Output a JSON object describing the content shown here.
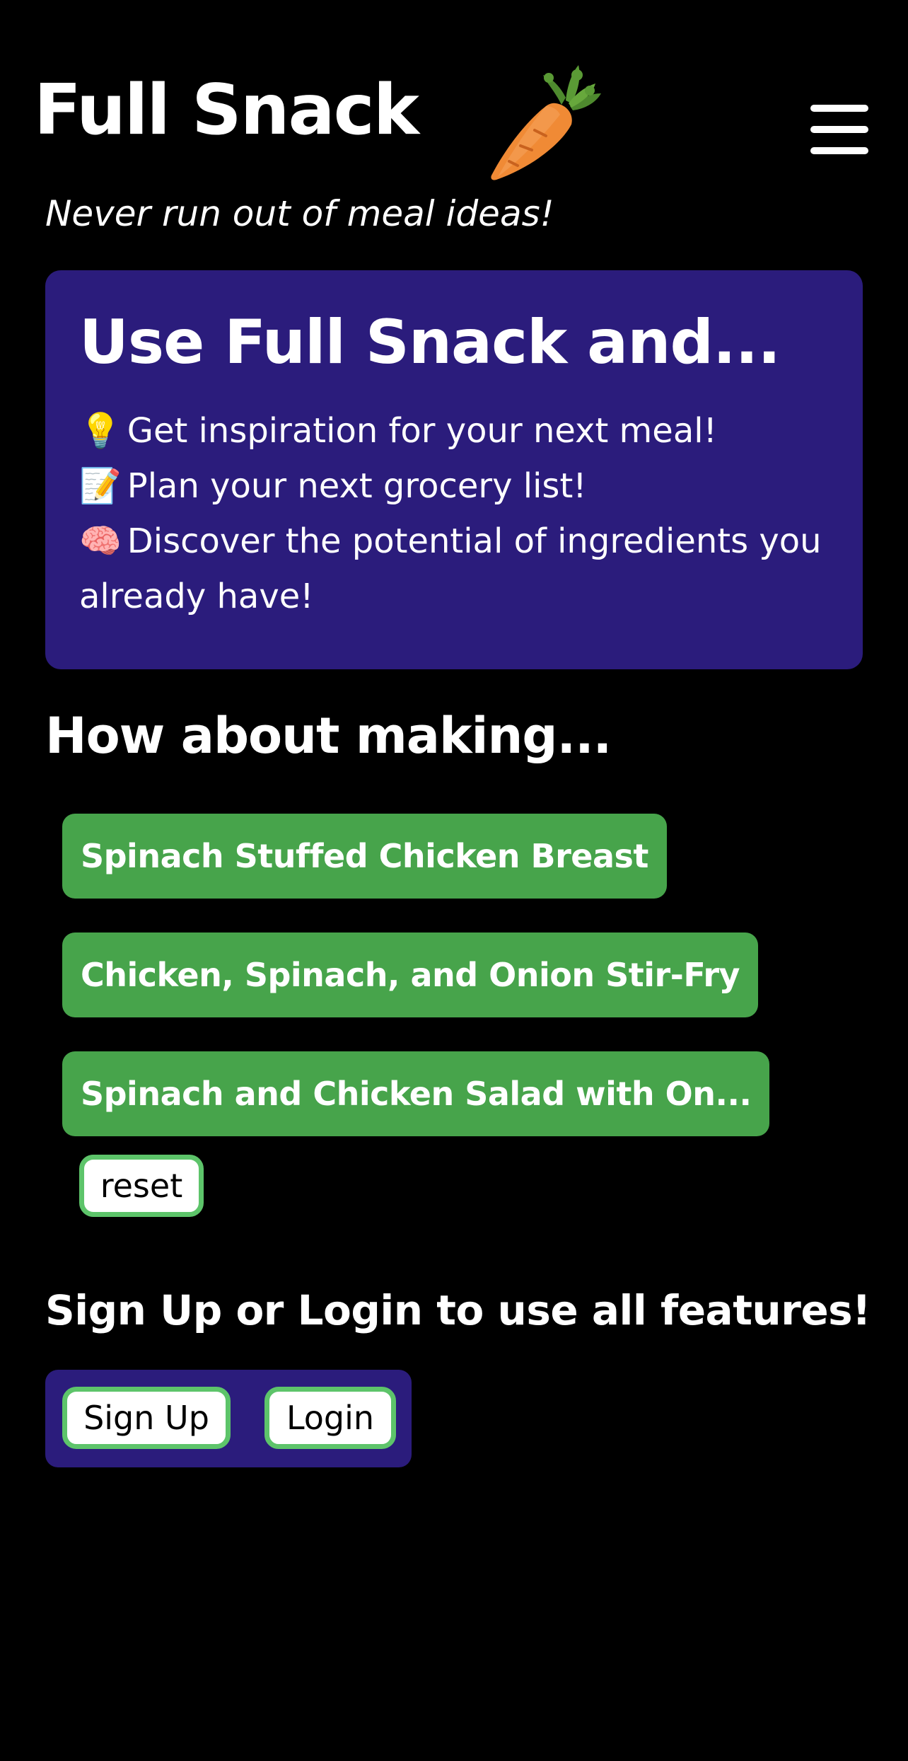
{
  "header": {
    "title": "Full Snack",
    "tagline": "Never run out of meal ideas!",
    "logo_icon": "carrot-icon",
    "menu_icon": "hamburger-menu-icon"
  },
  "intro": {
    "title": "Use Full Snack and...",
    "items": [
      {
        "emoji": "💡",
        "icon": "lightbulb-icon",
        "text": "Get inspiration for your next meal!"
      },
      {
        "emoji": "📝",
        "icon": "memo-icon",
        "text": "Plan your next grocery list!"
      },
      {
        "emoji": "🧠",
        "icon": "brain-icon",
        "text": "Discover the potential of ingredients you already have!"
      }
    ]
  },
  "suggestions": {
    "title": "How about making...",
    "items": [
      "Spinach Stuffed Chicken Breast",
      "Chicken, Spinach, and Onion Stir-Fry",
      "Spinach and Chicken Salad with On..."
    ],
    "reset_label": "reset"
  },
  "auth": {
    "title": "Sign Up or Login to use all features!",
    "signup_label": "Sign Up",
    "login_label": "Login"
  },
  "colors": {
    "background": "#000000",
    "card": "#2b1c7c",
    "suggestion": "#47a44b",
    "button_border": "#5dc46a"
  }
}
